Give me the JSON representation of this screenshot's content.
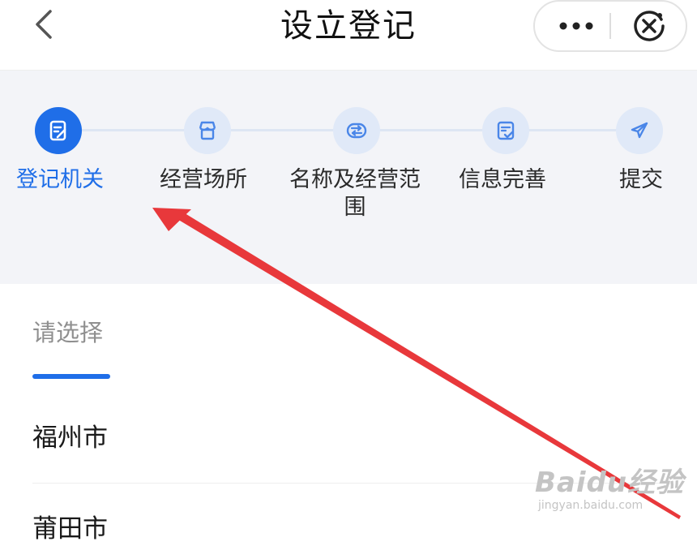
{
  "header": {
    "title": "设立登记",
    "back_icon": "chevron-left-icon",
    "more_icon": "more-dots-icon",
    "close_icon": "miniprogram-close-icon"
  },
  "steps": [
    {
      "label": "登记机关",
      "icon": "document-edit-icon",
      "active": true
    },
    {
      "label": "经营场所",
      "icon": "storefront-icon",
      "active": false
    },
    {
      "label": "名称及经营范围",
      "icon": "exchange-icon",
      "active": false
    },
    {
      "label": "信息完善",
      "icon": "form-check-icon",
      "active": false
    },
    {
      "label": "提交",
      "icon": "send-icon",
      "active": false
    }
  ],
  "selector": {
    "tab_label": "请选择",
    "cities": [
      "福州市",
      "莆田市"
    ]
  },
  "watermark": {
    "logo": "Baidu经验",
    "url": "jingyan.baidu.com"
  },
  "colors": {
    "accent": "#1f6ee8",
    "step_bg": "#f3f4f8",
    "step_circle": "#e0e9f8",
    "annotation_arrow": "#e8383b"
  }
}
